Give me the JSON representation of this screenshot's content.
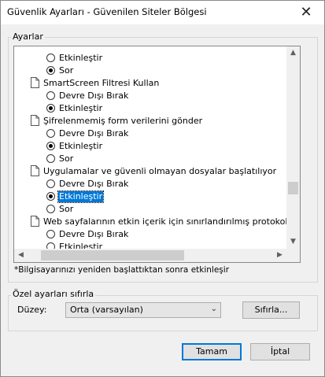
{
  "window": {
    "title": "Güvenlik Ayarları - Güvenilen Siteler Bölgesi",
    "close_glyph": "✕"
  },
  "settings_group": {
    "legend": "Ayarlar"
  },
  "settings_list": {
    "rows": [
      {
        "kind": "option",
        "label": "Etkinleştir",
        "checked": false
      },
      {
        "kind": "option",
        "label": "Sor",
        "checked": true
      },
      {
        "kind": "heading",
        "label": "SmartScreen Filtresi Kullan",
        "icon": "document-icon"
      },
      {
        "kind": "option",
        "label": "Devre Dışı Bırak",
        "checked": false
      },
      {
        "kind": "option",
        "label": "Etkinleştir",
        "checked": true
      },
      {
        "kind": "heading",
        "label": "Şifrelenmemiş form verilerini gönder",
        "icon": "document-icon"
      },
      {
        "kind": "option",
        "label": "Devre Dışı Bırak",
        "checked": false
      },
      {
        "kind": "option",
        "label": "Etkinleştir",
        "checked": true
      },
      {
        "kind": "option",
        "label": "Sor",
        "checked": false
      },
      {
        "kind": "heading",
        "label": "Uygulamalar ve güvenli olmayan dosyalar başlatılıyor",
        "icon": "document-icon"
      },
      {
        "kind": "option",
        "label": "Devre Dışı Bırak",
        "checked": false
      },
      {
        "kind": "option",
        "label": "Etkinleştir",
        "checked": true,
        "selected": true
      },
      {
        "kind": "option",
        "label": "Sor",
        "checked": false
      },
      {
        "kind": "heading",
        "label": "Web sayfalarının etkin içerik için sınırlandırılmış protokoller kull",
        "icon": "document-icon"
      },
      {
        "kind": "option",
        "label": "Devre Dışı Bırak",
        "checked": false
      },
      {
        "kind": "option",
        "label": "Etkinleştir",
        "checked": false
      }
    ],
    "scroll_arrows": {
      "up": "▲",
      "down": "▼",
      "left": "◀",
      "right": "▶"
    }
  },
  "restart_note": "*Bilgisayarınızı yeniden başlattıktan sonra etkinleşir",
  "reset_group": {
    "legend": "Özel ayarları sıfırla",
    "level_label": "Düzey:",
    "level_value": "Orta (varsayılan)",
    "reset_button": "Sıfırla..."
  },
  "footer": {
    "ok_button": "Tamam",
    "cancel_button": "İptal"
  }
}
